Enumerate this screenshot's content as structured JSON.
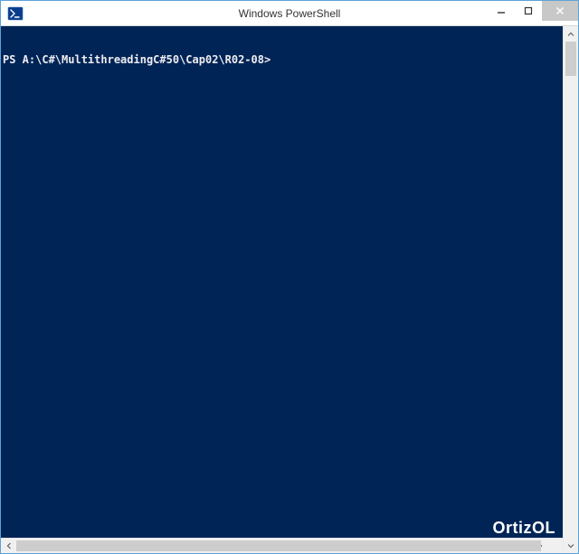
{
  "window": {
    "title": "Windows PowerShell"
  },
  "terminal": {
    "prompt": "PS A:\\C#\\MultithreadingC#50\\Cap02\\R02-08>",
    "watermark": "OrtizOL"
  },
  "colors": {
    "terminal_bg": "#012456",
    "terminal_fg": "#eeedf0"
  }
}
